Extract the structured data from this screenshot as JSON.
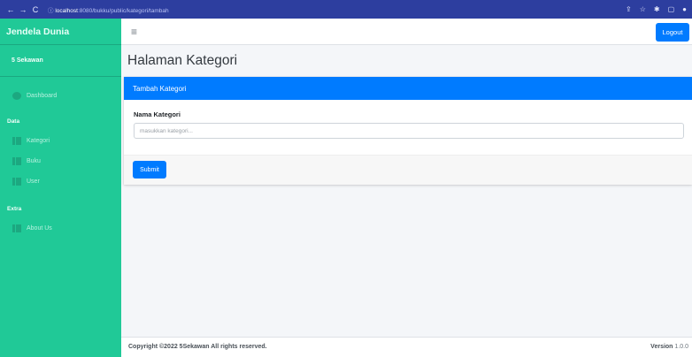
{
  "browser": {
    "back_icon": "arrow-left-icon",
    "forward_icon": "arrow-right-icon",
    "reload_icon": "reload-icon",
    "url_host": "localhost",
    "url_path": ":8080/bukku/public/kategori/tambah"
  },
  "sidebar": {
    "brand": "Jendela Dunia",
    "user": "5 Sekawan",
    "dashboard": "Dashboard",
    "section_data": "Data",
    "items": [
      {
        "label": "Kategori"
      },
      {
        "label": "Buku"
      },
      {
        "label": "User"
      }
    ],
    "section_extra": "Extra",
    "about": "About Us"
  },
  "topbar": {
    "menu_icon": "hamburger-icon",
    "logout_label": "Logout"
  },
  "page": {
    "title": "Halaman Kategori"
  },
  "form": {
    "header": "Tambah Kategori",
    "field_label": "Nama Kategori",
    "field_placeholder": "masukkan kategori...",
    "field_value": "",
    "submit_label": "Submit"
  },
  "footer": {
    "copyright": "Copyright ©2022 5Sekawan All rights reserved.",
    "version_label": "Version",
    "version_value": "1.0.0"
  },
  "colors": {
    "sidebar": "#20c997",
    "primary": "#007bff",
    "browser_bar": "#2d3e9f"
  }
}
